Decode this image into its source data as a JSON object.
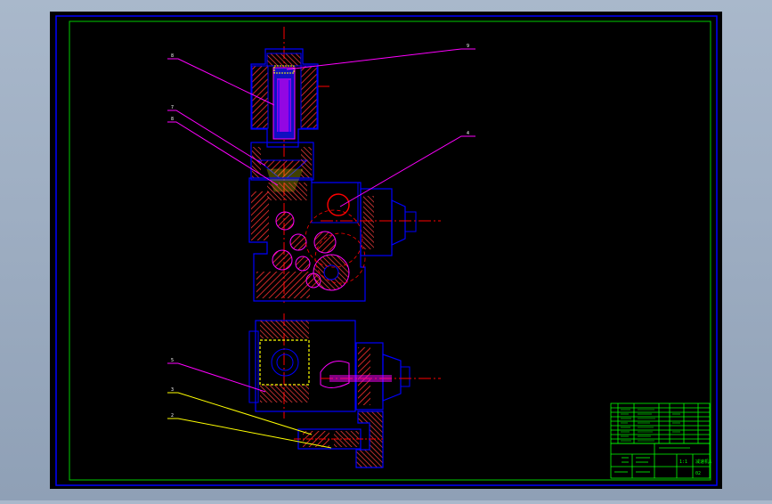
{
  "callouts": [
    {
      "label": "8"
    },
    {
      "label": "7"
    },
    {
      "label": "8"
    },
    {
      "label": "9"
    },
    {
      "label": "4"
    },
    {
      "label": "5"
    },
    {
      "label": "3"
    },
    {
      "label": "2"
    }
  ],
  "title_block": {
    "name_cell": "减速机A",
    "scale_cell": "1:1",
    "sheet_cell": "02"
  },
  "colors": {
    "sheet": "#000000",
    "frame": "#0000ff",
    "inner_frame": "#00ff00",
    "part_outline": "#0000ff",
    "hatch": "#ff3030",
    "leader": "#ff00ff",
    "centerline": "#ff0000",
    "leader_alt": "#ffff00",
    "table": "#00ff00"
  }
}
